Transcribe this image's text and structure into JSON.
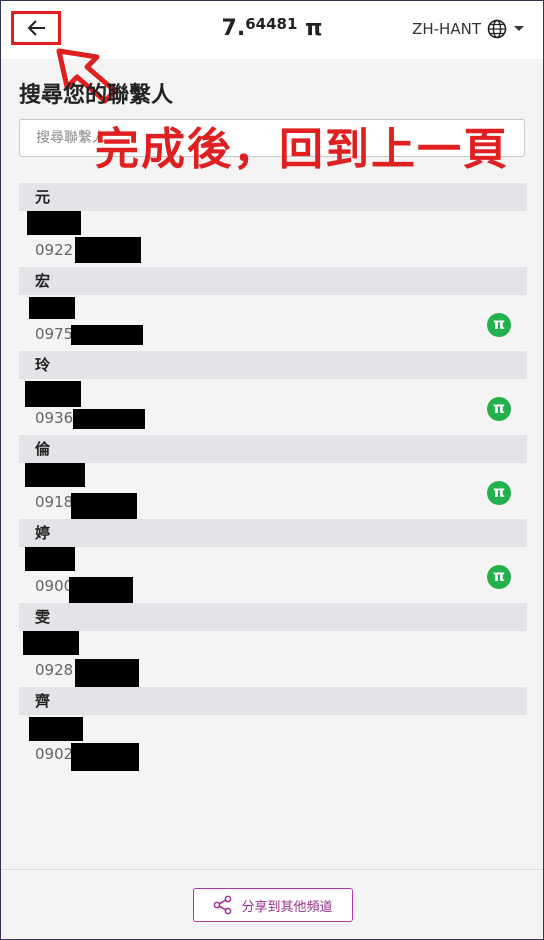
{
  "header": {
    "back_icon": "arrow-left-icon",
    "balance_main": "7.",
    "balance_sup": "64481",
    "balance_unit": "π",
    "language": "ZH-HANT",
    "language_icon": "globe-icon",
    "dropdown_icon": "caret-down-icon"
  },
  "section_title": "搜尋您的聯繫人",
  "search": {
    "placeholder": "搜尋聯繫人"
  },
  "annotation": "完成後，回到上一頁",
  "contacts": [
    {
      "group": "元",
      "phone_prefix": "0922",
      "pi_user": false
    },
    {
      "group": "宏",
      "phone_prefix": "0975",
      "pi_user": true
    },
    {
      "group": "玲",
      "phone_prefix": "0936",
      "pi_user": true
    },
    {
      "group": "倫",
      "phone_prefix": "0918",
      "pi_user": true
    },
    {
      "group": "婷",
      "phone_prefix": "0900",
      "pi_user": true
    },
    {
      "group": "雯",
      "phone_prefix": "0928",
      "pi_user": false
    },
    {
      "group": "齊",
      "phone_prefix": "0902",
      "pi_user": false
    }
  ],
  "pi_badge": "π",
  "footer": {
    "share_label": "分享到其他頻道",
    "share_icon": "share-icon"
  },
  "colors": {
    "annotation_red": "#e02020",
    "pi_green": "#22b14c",
    "share_purple": "#9c2f8f"
  }
}
